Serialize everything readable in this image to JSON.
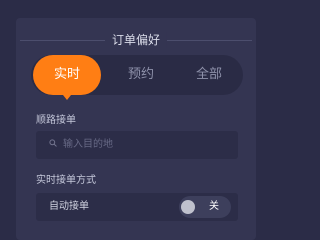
{
  "dialog": {
    "title": "订单偏好"
  },
  "order_type_tabs": {
    "items": [
      {
        "label": "实时",
        "selected": true
      },
      {
        "label": "预约",
        "selected": false
      },
      {
        "label": "全部",
        "selected": false
      }
    ]
  },
  "route_order": {
    "label": "顺路接单",
    "search_icon": "search-icon",
    "destination_value": "",
    "destination_placeholder": "输入目的地"
  },
  "realtime_mode": {
    "label": "实时接单方式",
    "auto_accept_label": "自动接单",
    "toggle_state": "关"
  },
  "colors": {
    "background": "#2b2c47",
    "panel": "#343552",
    "accent": "#ff7e14",
    "text": "#d9dbe8"
  }
}
